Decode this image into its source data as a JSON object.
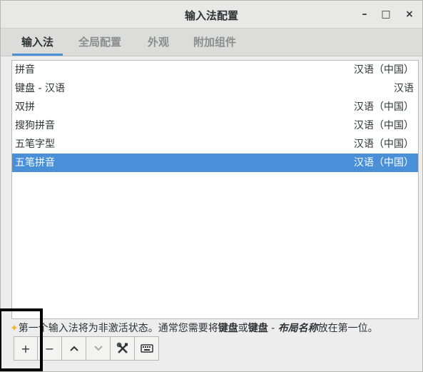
{
  "window": {
    "title": "输入法配置"
  },
  "controls": {
    "minimize": "–",
    "maximize": "□",
    "close": "×"
  },
  "tabs": [
    {
      "label": "输入法",
      "active": true
    },
    {
      "label": "全局配置",
      "active": false
    },
    {
      "label": "外观",
      "active": false
    },
    {
      "label": "附加组件",
      "active": false
    }
  ],
  "input_methods": [
    {
      "name": "拼音",
      "language": "汉语（中国）"
    },
    {
      "name": "键盘 - 汉语",
      "language": "汉语"
    },
    {
      "name": "双拼",
      "language": "汉语（中国）"
    },
    {
      "name": "搜狗拼音",
      "language": "汉语（中国）"
    },
    {
      "name": "五笔字型",
      "language": "汉语（中国）"
    },
    {
      "name": "五笔拼音",
      "language": "汉语（中国）",
      "selected": true
    }
  ],
  "hint": {
    "text_before": "第一个输入法将为非激活状态。通常您需要将",
    "bold_keyboard": "键盘",
    "or": "或",
    "bold_keyboard2": "键盘",
    "dash": " - ",
    "italic_layout": "布局名称",
    "text_after": "放在第一位。"
  },
  "toolbar": {
    "add": "+",
    "remove": "−",
    "up": "^",
    "down": "v",
    "configure_icon": "tools-icon",
    "keyboard_icon": "keyboard-icon"
  },
  "colors": {
    "accent": "#4a90d9",
    "star": "#f3b72b"
  }
}
